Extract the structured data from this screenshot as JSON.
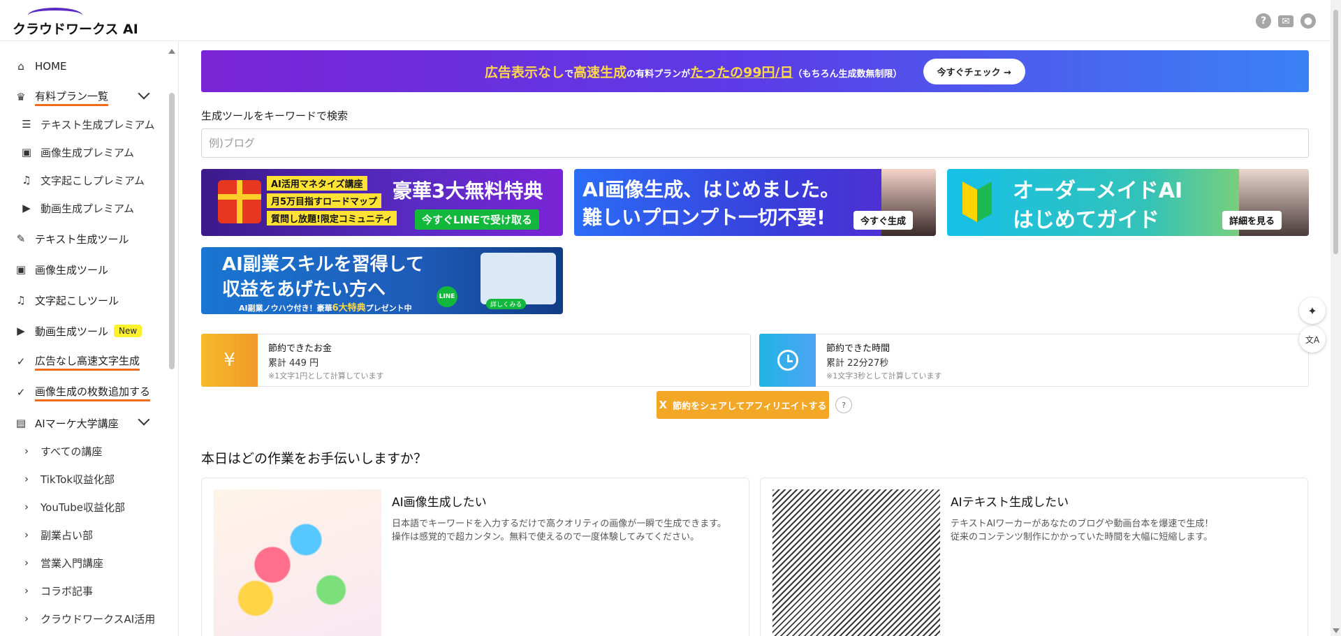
{
  "header": {
    "logo_text": "クラウドワークス AI",
    "icons": [
      "help-icon",
      "mail-icon",
      "account-icon"
    ]
  },
  "sidebar": {
    "items": [
      {
        "label": "HOME",
        "icon": "home-icon"
      },
      {
        "label": "有料プラン一覧",
        "icon": "crown-icon",
        "expandable": true,
        "highlighted": true
      },
      {
        "label": "テキスト生成プレミアム",
        "icon": "text-lines-icon",
        "sub": true
      },
      {
        "label": "画像生成プレミアム",
        "icon": "image-icon",
        "sub": true
      },
      {
        "label": "文字起こしプレミアム",
        "icon": "headphones-icon",
        "sub": true
      },
      {
        "label": "動画生成プレミアム",
        "icon": "video-icon",
        "sub": true
      },
      {
        "label": "テキスト生成ツール",
        "icon": "pen-icon"
      },
      {
        "label": "画像生成ツール",
        "icon": "image-icon"
      },
      {
        "label": "文字起こしツール",
        "icon": "headphones-icon"
      },
      {
        "label": "動画生成ツール",
        "icon": "video-icon",
        "badge": "New"
      },
      {
        "label": "広告なし高速文字生成",
        "icon": "check-circle-icon",
        "highlighted": true
      },
      {
        "label": "画像生成の枚数追加する",
        "icon": "check-circle-icon",
        "highlighted": true
      },
      {
        "label": "AIマーケ大学講座",
        "icon": "book-icon",
        "expandable": true
      },
      {
        "label": "すべての講座",
        "icon": "chevron-circle-icon",
        "sub": true
      },
      {
        "label": "TikTok収益化部",
        "icon": "chevron-circle-icon",
        "sub": true
      },
      {
        "label": "YouTube収益化部",
        "icon": "chevron-circle-icon",
        "sub": true
      },
      {
        "label": "副業占い部",
        "icon": "chevron-circle-icon",
        "sub": true
      },
      {
        "label": "営業入門講座",
        "icon": "chevron-circle-icon",
        "sub": true
      },
      {
        "label": "コラボ記事",
        "icon": "chevron-circle-icon",
        "sub": true
      },
      {
        "label": "クラウドワークスAI活用",
        "icon": "chevron-circle-icon",
        "sub": true
      }
    ]
  },
  "promo": {
    "part1": "広告表示なし",
    "part2": "で",
    "part3": "高速生成",
    "part4": "の有料プランが",
    "part5": "たったの99円/日",
    "part6": "（もちろん生成数無制限）",
    "button": "今すぐチェック →"
  },
  "search": {
    "label": "生成ツールをキーワードで検索",
    "placeholder": "例)ブログ",
    "value": ""
  },
  "banners": {
    "b1": {
      "tags": [
        "AI活用マネタイズ講座",
        "月5万目指すロードマップ",
        "質問し放題!限定コミュニティ"
      ],
      "headline": "豪華3大無料特典",
      "cta": "今すぐLINEで受け取る"
    },
    "b2": {
      "line1": "AI画像生成、はじめました。",
      "line2": "難しいプロンプト一切不要!",
      "cta": "今すぐ生成"
    },
    "b3": {
      "line1": "オーダーメイドAI",
      "line2": "はじめてガイド",
      "cta": "詳細を見る"
    },
    "b4": {
      "line1": "AI副業スキルを習得して",
      "line2": "収益をあげたい方へ",
      "footer_pre": "AI副業ノウハウ付き！豪華",
      "footer_highlight": "6大特典",
      "footer_post": "プレゼント中",
      "line_badge": "LINE",
      "mini_cta": "詳しくみる"
    }
  },
  "stats": {
    "money": {
      "title": "節約できたお金",
      "value": "累計  449  円",
      "note": "※1文字1円として計算しています",
      "icon_glyph": "¥"
    },
    "time": {
      "title": "節約できた時間",
      "value": "累計  22分27秒",
      "note": "※1文字3秒として計算しています"
    }
  },
  "share": {
    "x_glyph": "X",
    "label": "節約をシェアしてアフィリエイトする",
    "help": "?"
  },
  "section": {
    "title": "本日はどの作業をお手伝いしますか？"
  },
  "cards": [
    {
      "title": "AI画像生成したい",
      "desc1": "日本語でキーワードを入力するだけで高クオリティの画像が一瞬で生成できます。",
      "desc2": "操作は感覚的で超カンタン。無料で使えるので一度体験してみてください。"
    },
    {
      "title": "AIテキスト生成したい",
      "desc1": "テキストAIワーカーがあなたのブログや動画台本を爆速で生成！",
      "desc2": "従来のコンテンツ制作にかかっていた時間を大幅に短縮します。"
    }
  ],
  "floating": {
    "sparkle": "✦",
    "translate": "文A"
  },
  "colors": {
    "accent_purple": "#7a24d6",
    "accent_blue": "#3b82f6",
    "highlight_underline": "#f26b1d",
    "share_button": "#f2a726",
    "new_badge": "#fff12e"
  }
}
